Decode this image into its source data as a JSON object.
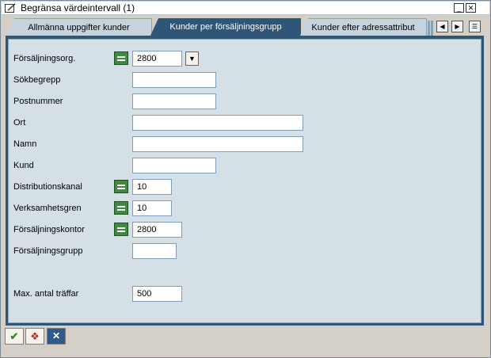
{
  "window": {
    "title": "Begränsa värdeintervall (1)"
  },
  "tabs": [
    {
      "label": "Allmänna uppgifter kunder"
    },
    {
      "label": "Kunder per försäljningsgrupp"
    },
    {
      "label": "Kunder efter adressattribut"
    }
  ],
  "tab_nav": {
    "prev": "◀",
    "next": "▶",
    "menu": "☰"
  },
  "form": {
    "fields": [
      {
        "label": "Försäljningsorg.",
        "value": "2800",
        "select_option": true,
        "value_help": true
      },
      {
        "label": "Sökbegrepp",
        "value": ""
      },
      {
        "label": "Postnummer",
        "value": ""
      },
      {
        "label": "Ort",
        "value": ""
      },
      {
        "label": "Namn",
        "value": ""
      },
      {
        "label": "Kund",
        "value": ""
      },
      {
        "label": "Distributionskanal",
        "value": "10",
        "select_option": true
      },
      {
        "label": "Verksamhetsgren",
        "value": "10",
        "select_option": true
      },
      {
        "label": "Försäljningskontor",
        "value": "2800",
        "select_option": true
      },
      {
        "label": "Försäljningsgrupp",
        "value": ""
      }
    ],
    "max_hits": {
      "label": "Max. antal träffar",
      "value": "500"
    }
  },
  "footer": {
    "ok_icon": "checkmark-icon",
    "multi_icon": "multiple-select-icon",
    "cancel_icon": "cancel-x-icon"
  },
  "colors": {
    "active_tab": "#2f5677",
    "panel": "#d4dfe6",
    "select_button": "#3f8a3f"
  }
}
